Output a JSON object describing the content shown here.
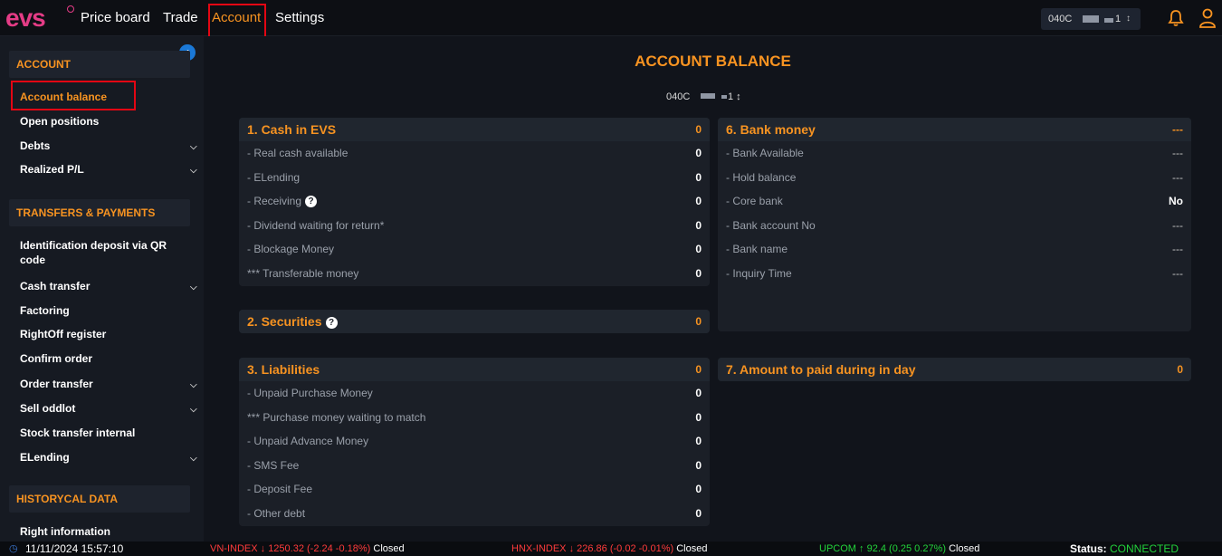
{
  "topbar": {
    "logo_text": "evs",
    "nav": [
      "Price board",
      "Trade",
      "Account",
      "Settings"
    ],
    "active_nav": "Account",
    "account_select": {
      "prefix": "040C",
      "suffix": "1",
      "arrow": "↕"
    },
    "icons": [
      "bell-icon",
      "user-icon"
    ],
    "accent": "#f79321",
    "highlight_box": "#e30613"
  },
  "sidebar": {
    "sections": [
      {
        "title": "ACCOUNT",
        "items": [
          {
            "label": "Account balance",
            "active": true,
            "expandable": false
          },
          {
            "label": "Open positions",
            "expandable": false
          },
          {
            "label": "Debts",
            "expandable": true
          },
          {
            "label": "Realized P/L",
            "expandable": true
          }
        ]
      },
      {
        "title": "TRANSFERS & PAYMENTS",
        "items": [
          {
            "label": "Identification deposit via QR",
            "label2": "code",
            "expandable": false
          },
          {
            "label": "Cash transfer",
            "expandable": true
          },
          {
            "label": "Factoring",
            "expandable": false
          },
          {
            "label": "RightOff register",
            "expandable": false
          },
          {
            "label": "Confirm order",
            "expandable": false
          },
          {
            "label": "Order transfer",
            "expandable": true
          },
          {
            "label": "Sell oddlot",
            "expandable": true
          },
          {
            "label": "Stock transfer internal",
            "expandable": false
          },
          {
            "label": "ELending",
            "expandable": true
          }
        ]
      },
      {
        "title": "HISTORYCAL DATA",
        "items": [
          {
            "label": "Right information",
            "expandable": false
          }
        ]
      }
    ],
    "collapse_icon": "chevron-left-icon"
  },
  "main": {
    "title": "ACCOUNT BALANCE",
    "account_select": {
      "prefix": "040C",
      "suffix": "1"
    },
    "panels": {
      "cash": {
        "title": "1. Cash in EVS",
        "value": "0",
        "rows": [
          {
            "label": "- Real cash available",
            "value": "0"
          },
          {
            "label": "- ELending",
            "value": "0"
          },
          {
            "label": "- Receiving",
            "value": "0",
            "help": true
          },
          {
            "label": "- Dividend waiting for return*",
            "value": "0"
          },
          {
            "label": "- Blockage Money",
            "value": "0"
          },
          {
            "label": "*** Transferable money",
            "value": "0"
          }
        ]
      },
      "securities": {
        "title": "2. Securities",
        "value": "0",
        "help": true
      },
      "liabilities": {
        "title": "3. Liabilities",
        "value": "0",
        "rows": [
          {
            "label": "- Unpaid Purchase Money",
            "value": "0"
          },
          {
            "label": "*** Purchase money waiting to match",
            "value": "0"
          },
          {
            "label": "- Unpaid Advance Money",
            "value": "0"
          },
          {
            "label": "- SMS Fee",
            "value": "0"
          },
          {
            "label": "- Deposit Fee",
            "value": "0"
          },
          {
            "label": "- Other debt",
            "value": "0"
          }
        ]
      },
      "bank": {
        "title": "6. Bank money",
        "value": "---",
        "rows": [
          {
            "label": "- Bank Available",
            "value": "---"
          },
          {
            "label": "- Hold balance",
            "value": "---"
          },
          {
            "label": "- Core bank",
            "value": "No"
          },
          {
            "label": "- Bank account No",
            "value": "---"
          },
          {
            "label": "- Bank name",
            "value": "---"
          },
          {
            "label": "- Inquiry Time",
            "value": "---"
          }
        ]
      },
      "amount": {
        "title": "7. Amount to paid during in day",
        "value": "0"
      }
    }
  },
  "statusbar": {
    "datetime": "11/11/2024 15:57:10",
    "vnindex": {
      "name": "VN-INDEX",
      "arrow": "↓",
      "value": "1250.32 (-2.24 -0.18%)",
      "state": "Closed"
    },
    "hnxindex": {
      "name": "HNX-INDEX",
      "arrow": "↓",
      "value": "226.86 (-0.02 -0.01%)",
      "state": "Closed"
    },
    "upcom": {
      "name": "UPCOM",
      "arrow": "↑",
      "value": "92.4 (0.25 0.27%)",
      "state": "Closed"
    },
    "status_label": "Status:",
    "status_value": "CONNECTED"
  }
}
